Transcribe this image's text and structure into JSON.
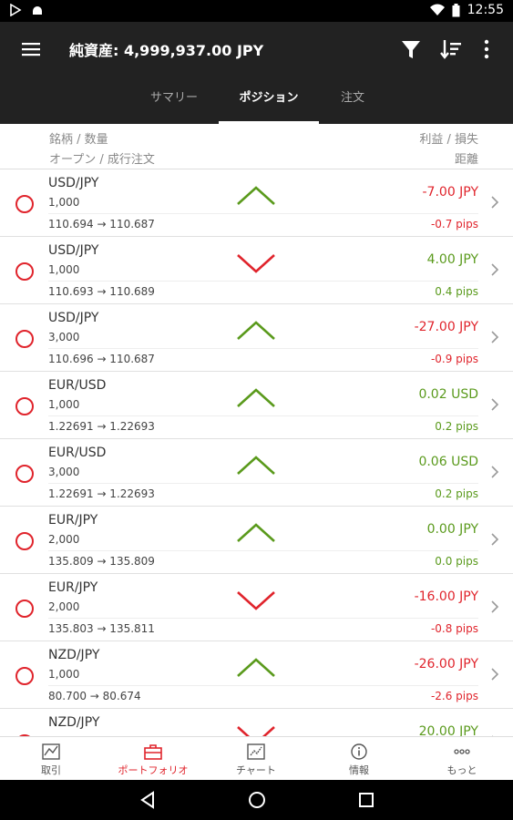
{
  "status": {
    "time": "12:55"
  },
  "appbar": {
    "title": "純資産: 4,999,937.00 JPY"
  },
  "tabs": [
    {
      "label": "サマリー"
    },
    {
      "label": "ポジション"
    },
    {
      "label": "注文"
    }
  ],
  "header": {
    "left1": "銘柄 / 数量",
    "left2": "オープン / 成行注文",
    "right1": "利益 / 損失",
    "right2": "距離"
  },
  "positions": [
    {
      "symbol": "USD/JPY",
      "qty": "1,000",
      "rate": "110.694 → 110.687",
      "direction": "up",
      "pl": "-7.00 JPY",
      "dist": "-0.7 pips",
      "tone": "neg"
    },
    {
      "symbol": "USD/JPY",
      "qty": "1,000",
      "rate": "110.693 → 110.689",
      "direction": "down",
      "pl": "4.00 JPY",
      "dist": "0.4 pips",
      "tone": "pos"
    },
    {
      "symbol": "USD/JPY",
      "qty": "3,000",
      "rate": "110.696 → 110.687",
      "direction": "up",
      "pl": "-27.00 JPY",
      "dist": "-0.9 pips",
      "tone": "neg"
    },
    {
      "symbol": "EUR/USD",
      "qty": "1,000",
      "rate": "1.22691 → 1.22693",
      "direction": "up",
      "pl": "0.02 USD",
      "dist": "0.2 pips",
      "tone": "pos"
    },
    {
      "symbol": "EUR/USD",
      "qty": "3,000",
      "rate": "1.22691 → 1.22693",
      "direction": "up",
      "pl": "0.06 USD",
      "dist": "0.2 pips",
      "tone": "pos"
    },
    {
      "symbol": "EUR/JPY",
      "qty": "2,000",
      "rate": "135.809 → 135.809",
      "direction": "up",
      "pl": "0.00 JPY",
      "dist": "0.0 pips",
      "tone": "pos"
    },
    {
      "symbol": "EUR/JPY",
      "qty": "2,000",
      "rate": "135.803 → 135.811",
      "direction": "down",
      "pl": "-16.00 JPY",
      "dist": "-0.8 pips",
      "tone": "neg"
    },
    {
      "symbol": "NZD/JPY",
      "qty": "1,000",
      "rate": "80.700 → 80.674",
      "direction": "up",
      "pl": "-26.00 JPY",
      "dist": "-2.6 pips",
      "tone": "neg"
    },
    {
      "symbol": "NZD/JPY",
      "qty": "",
      "rate": "",
      "direction": "down",
      "pl": "20.00 JPY",
      "dist": "",
      "tone": "pos"
    }
  ],
  "bottomnav": [
    {
      "label": "取引",
      "icon": "trade-icon"
    },
    {
      "label": "ポートフォリオ",
      "icon": "briefcase-icon"
    },
    {
      "label": "チャート",
      "icon": "chart-icon"
    },
    {
      "label": "情報",
      "icon": "info-icon"
    },
    {
      "label": "もっと",
      "icon": "more-icon"
    }
  ],
  "colors": {
    "negative": "#e0242c",
    "positive": "#5a9a1c",
    "appbar": "#222222"
  }
}
